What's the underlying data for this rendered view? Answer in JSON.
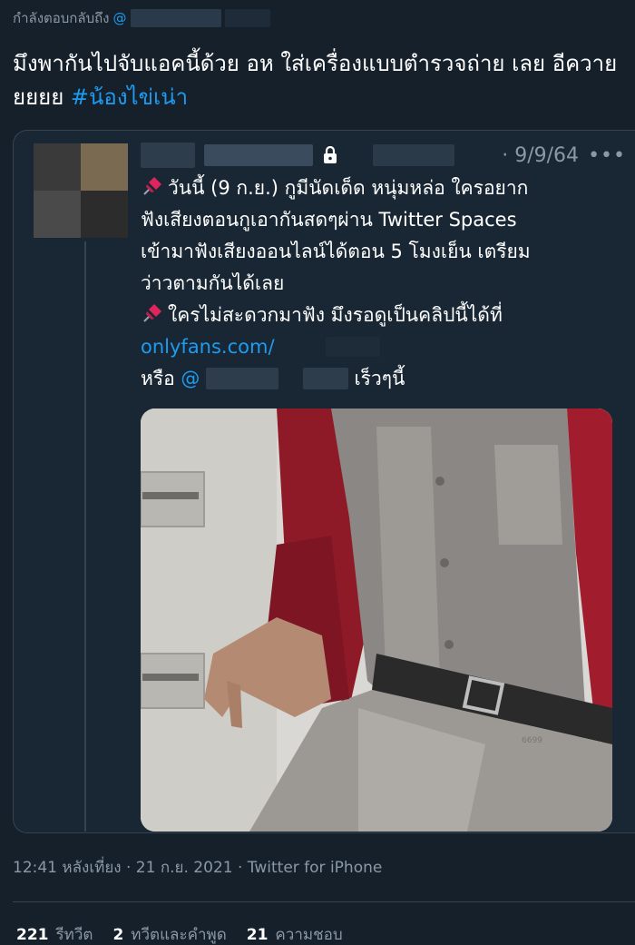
{
  "reply": {
    "prefix": "กำลังตอบกลับถึง",
    "mention_start": "@"
  },
  "tweet": {
    "text": "มึงพากันไปจับแอคนี้ด้วย อห ใส่เครื่องแบบตำรวจถ่าย เลย อีควายยยยย",
    "hashtag": "#น้องไข่เน่า"
  },
  "quote": {
    "date": "· 9/9/64",
    "more": "•••",
    "lines": [
      "วันนี้ (9 ก.ย.) กูมีนัดเด็ด หนุ่มหล่อ ใครอยาก",
      "ฟังเสียงตอนกูเอากันสดๆผ่าน Twitter Spaces",
      "เข้ามาฟังเสียงออนไลน์ได้ตอน 5 โมงเย็น เตรียม",
      "ว่าวตามกันได้เลย",
      "ใครไม่สะดวกมาฟัง มึงรอดูเป็นคลิปนี้ได้ที่"
    ],
    "link": "onlyfans.com/",
    "or_label": "หรือ",
    "or_mention": "@",
    "or_suffix": "เร็วๆนี้",
    "watermark": "6699"
  },
  "meta": {
    "time": "12:41 หลังเที่ยง · 21 ก.ย. 2021 · Twitter for iPhone"
  },
  "stats": {
    "retweets_num": "221",
    "retweets_label": "รีทวีต",
    "quotes_num": "2",
    "quotes_label": "ทวีตและคำพูด",
    "likes_num": "21",
    "likes_label": "ความชอบ"
  },
  "colors": {
    "background": "#15202b",
    "accent": "#1d9bf0",
    "muted": "#8b98a5"
  }
}
